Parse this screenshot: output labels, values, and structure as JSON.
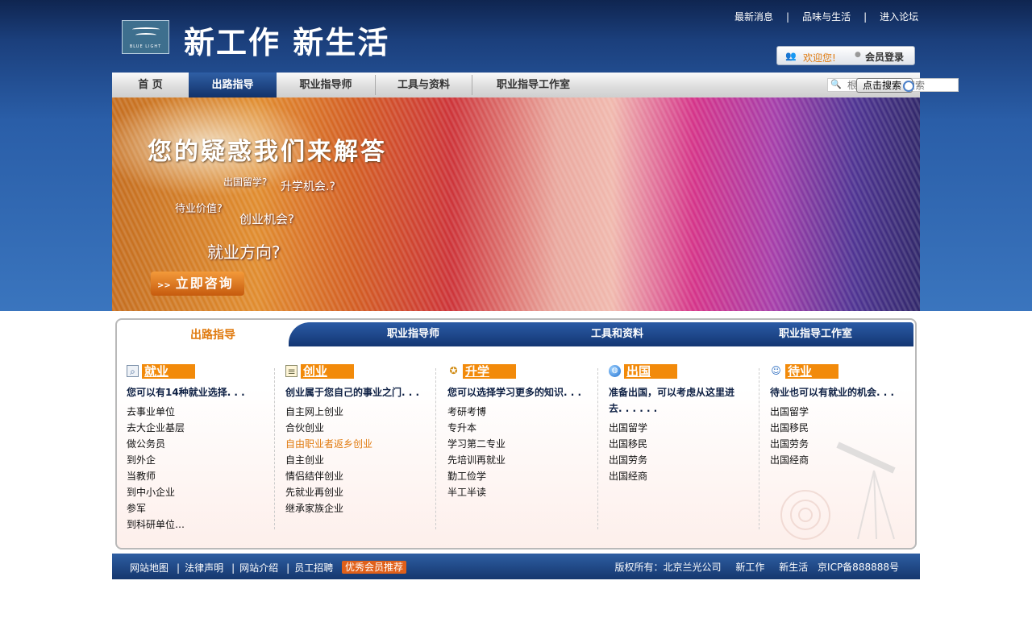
{
  "header": {
    "logo_text": "BLUE LIGHT",
    "slogan": "新工作 新生活",
    "top_links": [
      "最新消息",
      "品味与生活",
      "进入论坛"
    ],
    "welcome_text": "欢迎您!",
    "login_label": "会员登录"
  },
  "nav": {
    "items": [
      "首 页",
      "出路指导",
      "职业指导师",
      "工具与资料",
      "职业指导工作室"
    ],
    "active": "出路指导",
    "search_placeholder": "根据栏目进行搜索",
    "search_button": "点击搜索"
  },
  "banner": {
    "headline": "您的疑惑我们来解答",
    "questions": [
      "出国留学?",
      "升学机会.?",
      "待业价值?",
      "创业机会?",
      "就业方向?"
    ],
    "consult_button": "立即咨询",
    "consult_arrows": ">>"
  },
  "panel": {
    "tabs": [
      "出路指导",
      "职业指导师",
      "工具和资料",
      "职业指导工作室"
    ],
    "columns": [
      {
        "title": "就业",
        "icon": "magnifier-doc-icon",
        "intro": "您可以有14种就业选择. . .",
        "items": [
          "去事业单位",
          "去大企业基层",
          "做公务员",
          "到外企",
          "当教师",
          "到中小企业",
          "参军",
          "到科研单位…"
        ]
      },
      {
        "title": "创业",
        "icon": "document-icon",
        "intro": "创业属于您自己的事业之门. . .",
        "items": [
          "自主网上创业",
          "合伙创业",
          "自由职业者返乡创业",
          "自主创业",
          "情侣结伴创业",
          "先就业再创业",
          "继承家族企业"
        ]
      },
      {
        "title": "升学",
        "icon": "award-icon",
        "intro": "您可以选择学习更多的知识. . .",
        "items": [
          "考研考博",
          "专升本",
          "学习第二专业",
          "先培训再就业",
          "勤工俭学",
          "半工半读"
        ]
      },
      {
        "title": "出国",
        "icon": "globe-icon",
        "intro": "准备出国，可以考虑从这里进去. . . . . .",
        "items": [
          "出国留学",
          "出国移民",
          "出国劳务",
          "出国经商"
        ]
      },
      {
        "title": "待业",
        "icon": "person-icon",
        "intro": "待业也可以有就业的机会. . .",
        "items": [
          "出国留学",
          "出国移民",
          "出国劳务",
          "出国经商"
        ]
      }
    ],
    "highlighted_item": "自由职业者返乡创业"
  },
  "footer": {
    "links": [
      "网站地图",
      "法律声明",
      "网站介绍",
      "员工招聘"
    ],
    "badge": "优秀会员推荐",
    "copyright": "版权所有：北京兰光公司",
    "tags": [
      "新工作",
      "新生活"
    ],
    "icp": "京ICP备888888号"
  },
  "colors": {
    "accent": "#f28a0a",
    "nav_active": "#1b4585",
    "header_dark": "#0f2550"
  }
}
